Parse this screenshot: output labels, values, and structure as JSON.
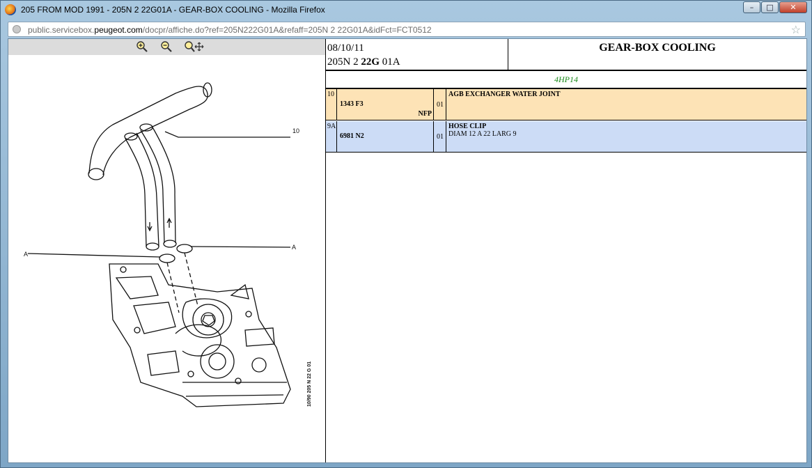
{
  "window": {
    "title": "205 FROM MOD 1991 - 205N 2 22G01A - GEAR-BOX COOLING - Mozilla Firefox",
    "buttons": {
      "minimize": "–",
      "maximize": "□",
      "close": "✕"
    }
  },
  "urlbar": {
    "url_prefix": "public.servicebox.",
    "url_domain": "peugeot.com",
    "url_rest": "/docpr/affiche.do?ref=205N222G01A&refaff=205N 2 22G01A&idFct=FCT0512"
  },
  "viewer": {
    "zoom_in_icon": "zoom-in-icon",
    "zoom_out_icon": "zoom-out-icon",
    "pan_icon": "zoom-pan-icon",
    "callouts": {
      "part10": "10",
      "sectionA_left": "A",
      "sectionA_right": "A"
    },
    "drawing_code": "10/90 205 N  22 G 01"
  },
  "sheet": {
    "date": "08/10/11",
    "ref_prefix": "205N 2 ",
    "ref_bold": "22G",
    "ref_suffix": " 01A",
    "title": "GEAR-BOX COOLING",
    "model": "4HP14",
    "model_color": "#1a8a1a"
  },
  "parts": [
    {
      "ref": "10",
      "number": "1343 F3",
      "note": "NFP",
      "qty": "01",
      "name": "AGB EXCHANGER WATER JOINT",
      "detail": "",
      "bg": "#fde3b6"
    },
    {
      "ref": "9A",
      "number": "6981 N2",
      "note": "",
      "qty": "01",
      "name": "HOSE CLIP",
      "detail": "DIAM 12 A 22 LARG 9",
      "bg": "#ccdcf6"
    }
  ]
}
